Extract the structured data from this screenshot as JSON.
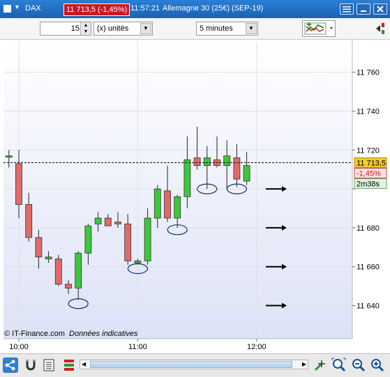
{
  "titlebar": {
    "symbol": "DAX",
    "price": "11 713,5 (-1,45%)",
    "time": "11:57:21",
    "instrument": "Allemagne 30 (25€) (SEP-19)"
  },
  "toolbar": {
    "units_value": "15",
    "units_type": "(x) unités",
    "timeframe": "5 minutes"
  },
  "overlay": {
    "price_label": "11 713,5",
    "change_label": "-1,45%",
    "countdown": "2m38s",
    "copyright": "© IT-Finance.com",
    "note": "Données indicatives"
  },
  "chart_data": {
    "type": "candlestick",
    "interval": "5 minutes",
    "y_ticks": [
      11640,
      11660,
      11680,
      11700,
      11720,
      11740,
      11760
    ],
    "y_tick_labels": [
      "11 640",
      "11 660",
      "11 680",
      "",
      "11 720",
      "11 740",
      "11 760"
    ],
    "ylim": [
      11623,
      11776
    ],
    "x_ticks": [
      {
        "t": 0,
        "label": "10:00"
      },
      {
        "t": 12,
        "label": "11:00"
      },
      {
        "t": 24,
        "label": "12:00"
      }
    ],
    "current_price": 11713.5,
    "candles": [
      {
        "t": -1,
        "o": 11717,
        "h": 11720,
        "l": 11711,
        "c": 11717
      },
      {
        "t": 0,
        "o": 11713,
        "h": 11720,
        "l": 11685,
        "c": 11692
      },
      {
        "t": 1,
        "o": 11692,
        "h": 11698,
        "l": 11673,
        "c": 11675
      },
      {
        "t": 2,
        "o": 11675,
        "h": 11679,
        "l": 11659,
        "c": 11665
      },
      {
        "t": 3,
        "o": 11664,
        "h": 11668,
        "l": 11662,
        "c": 11665
      },
      {
        "t": 4,
        "o": 11664,
        "h": 11666,
        "l": 11650,
        "c": 11651
      },
      {
        "t": 5,
        "o": 11651,
        "h": 11653,
        "l": 11646,
        "c": 11649
      },
      {
        "t": 6,
        "o": 11649,
        "h": 11668,
        "l": 11643,
        "c": 11667
      },
      {
        "t": 7,
        "o": 11667,
        "h": 11682,
        "l": 11661,
        "c": 11681
      },
      {
        "t": 8,
        "o": 11682,
        "h": 11688,
        "l": 11678,
        "c": 11685
      },
      {
        "t": 9,
        "o": 11685,
        "h": 11687,
        "l": 11681,
        "c": 11681
      },
      {
        "t": 10,
        "o": 11683,
        "h": 11688,
        "l": 11680,
        "c": 11682
      },
      {
        "t": 11,
        "o": 11682,
        "h": 11687,
        "l": 11661,
        "c": 11663
      },
      {
        "t": 12,
        "o": 11662,
        "h": 11664,
        "l": 11661,
        "c": 11663
      },
      {
        "t": 13,
        "o": 11663,
        "h": 11690,
        "l": 11661,
        "c": 11685
      },
      {
        "t": 14,
        "o": 11685,
        "h": 11702,
        "l": 11680,
        "c": 11700
      },
      {
        "t": 15,
        "o": 11699,
        "h": 11712,
        "l": 11683,
        "c": 11685
      },
      {
        "t": 16,
        "o": 11685,
        "h": 11697,
        "l": 11680,
        "c": 11696
      },
      {
        "t": 17,
        "o": 11696,
        "h": 11727,
        "l": 11690,
        "c": 11715
      },
      {
        "t": 18,
        "o": 11716,
        "h": 11732,
        "l": 11710,
        "c": 11712
      },
      {
        "t": 19,
        "o": 11712,
        "h": 11722,
        "l": 11700,
        "c": 11716
      },
      {
        "t": 20,
        "o": 11715,
        "h": 11727,
        "l": 11711,
        "c": 11712
      },
      {
        "t": 21,
        "o": 11712,
        "h": 11725,
        "l": 11700,
        "c": 11717
      },
      {
        "t": 22,
        "o": 11716,
        "h": 11723,
        "l": 11701,
        "c": 11705
      },
      {
        "t": 23,
        "o": 11704,
        "h": 11719,
        "l": 11702,
        "c": 11712
      }
    ],
    "markers": [
      {
        "t": 6,
        "price": 11641
      },
      {
        "t": 12,
        "price": 11659
      },
      {
        "t": 16,
        "price": 11679
      },
      {
        "t": 19,
        "price": 11700
      },
      {
        "t": 22,
        "price": 11700
      }
    ],
    "arrows": [
      11700,
      11680,
      11660,
      11640
    ],
    "colors": {
      "up": "#3cc83c",
      "down": "#e06a6a",
      "wick": "#222222",
      "grid": "#e0e0e0"
    }
  }
}
